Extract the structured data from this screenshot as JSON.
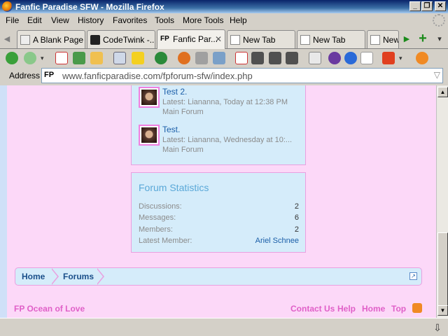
{
  "window": {
    "title": "Fanfic Paradise SFW - Mozilla Firefox",
    "controls": [
      "_",
      "❐",
      "✕"
    ]
  },
  "menu": [
    "File",
    "Edit",
    "View",
    "History",
    "Favorites",
    "Tools",
    "More Tools",
    "Help"
  ],
  "tabs": [
    {
      "label": "A Blank Page",
      "icon": "page-icon",
      "active": false
    },
    {
      "label": "CodeTwink -...",
      "icon": "lock-icon",
      "active": false
    },
    {
      "label": "Fanfic Par...",
      "icon": "fp-icon",
      "active": true,
      "icon_text": "FP",
      "close": "✕"
    },
    {
      "label": "New Tab",
      "icon": "page-icon",
      "active": false
    },
    {
      "label": "New Tab",
      "icon": "page-icon",
      "active": false
    },
    {
      "label": "New",
      "icon": "page-icon",
      "active": false
    }
  ],
  "tabstrip": {
    "scroll_left": "◀",
    "scroll_right": "▶",
    "new_tab": "+",
    "list": "▾"
  },
  "address": {
    "label": "Address",
    "favicon_text": "FP",
    "url": "www.fanficparadise.com/fpforum-sfw/index.php",
    "dropdown": "▽"
  },
  "threads": [
    {
      "title": "Test 2.",
      "meta": "Latest: Liananna, Today at 12:38 PM",
      "forum": "Main Forum"
    },
    {
      "title": "Test.",
      "meta": "Latest: Liananna, Wednesday at 10:...",
      "forum": "Main Forum"
    }
  ],
  "stats": {
    "title": "Forum Statistics",
    "rows": [
      {
        "label": "Discussions:",
        "value": "2"
      },
      {
        "label": "Messages:",
        "value": "6"
      },
      {
        "label": "Members:",
        "value": "2"
      },
      {
        "label": "Latest Member:",
        "value": "Ariel Schnee"
      }
    ]
  },
  "breadcrumb": {
    "items": [
      "Home",
      "Forums"
    ],
    "jump": "↗"
  },
  "footer": {
    "site": "FP Ocean of Love",
    "links": [
      "Contact Us",
      "Help",
      "Home",
      "Top"
    ],
    "rss": "RSS"
  },
  "scrollbar": {
    "up": "▲",
    "down": "▼"
  },
  "status_icon": "⇩",
  "colors": {
    "page_bg": "#fcd8f8",
    "panel_bg": "#d5ecfa",
    "panel_border": "#e9a0e0",
    "link": "#1a5ea8",
    "footer_link": "#e060c8",
    "stats_title": "#5aa8d8"
  }
}
